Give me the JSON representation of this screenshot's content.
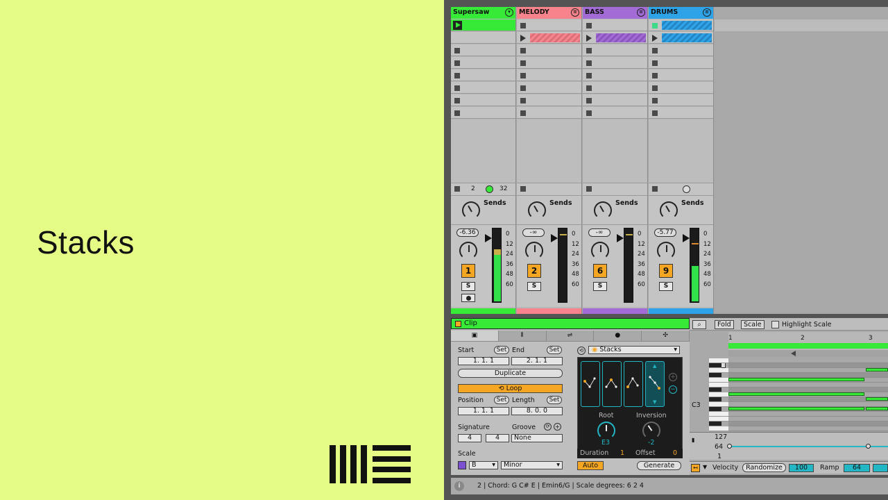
{
  "slide": {
    "title": "Stacks"
  },
  "session": {
    "tracks": [
      {
        "name": "Supersaw",
        "color": "#38ea38",
        "volume": "-6.36",
        "number": "1",
        "solo": "S",
        "sends": "Sends",
        "stop_a": "2",
        "stop_b": "32",
        "meter": 0.55
      },
      {
        "name": "MELODY",
        "color": "#f7848c",
        "volume": "-∞",
        "number": "2",
        "solo": "S",
        "sends": "Sends",
        "meter": 0
      },
      {
        "name": "BASS",
        "color": "#a36bd6",
        "volume": "-∞",
        "number": "6",
        "solo": "S",
        "sends": "Sends",
        "meter": 0
      },
      {
        "name": "DRUMS",
        "color": "#2fa3e8",
        "volume": "-5.77",
        "number": "9",
        "solo": "S",
        "sends": "Sends",
        "meter": 0.45
      }
    ],
    "meter_scale": [
      "0",
      "12",
      "24",
      "36",
      "48",
      "60"
    ]
  },
  "clip": {
    "header": "Clip",
    "start_label": "Start",
    "end_label": "End",
    "set": "Set",
    "start": "1.  1.  1",
    "end": "2.  1.  1",
    "duplicate": "Duplicate",
    "loop": "Loop",
    "position_label": "Position",
    "length_label": "Length",
    "position": "1.  1.  1",
    "length": "8.  0.  0",
    "signature_label": "Signature",
    "groove_label": "Groove",
    "sig_num": "4",
    "sig_den": "4",
    "groove": "None",
    "scale_label": "Scale",
    "scale_root": "B",
    "scale_mode": "Minor"
  },
  "stacks": {
    "device": "Stacks",
    "root_label": "Root",
    "root_value": "E3",
    "inversion_label": "Inversion",
    "inversion_value": "-2",
    "duration_label": "Duration",
    "duration_value": "1",
    "offset_label": "Offset",
    "offset_value": "0",
    "auto": "Auto",
    "generate": "Generate"
  },
  "piano": {
    "fold": "Fold",
    "scale": "Scale",
    "highlight": "Highlight Scale",
    "bar1": "1",
    "bar2": "2",
    "bar3": "3",
    "key_label": "C3",
    "vel_127": "127",
    "vel_64": "64",
    "vel_1": "1",
    "velocity_label": "Velocity",
    "randomize": "Randomize",
    "vel_value": "100",
    "ramp_label": "Ramp",
    "ramp_value": "64"
  },
  "status": {
    "text": "2 | Chord: G C# E | Emin6/G | Scale degrees: 6 2 4"
  }
}
